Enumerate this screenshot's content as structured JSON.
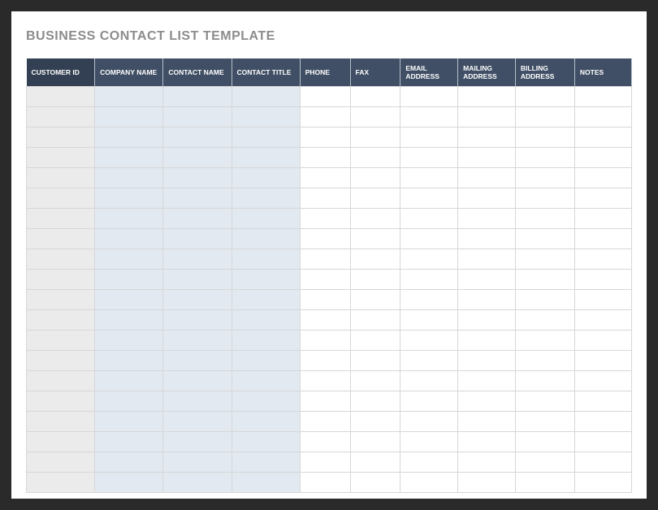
{
  "title": "BUSINESS CONTACT LIST TEMPLATE",
  "columns": [
    "CUSTOMER ID",
    "COMPANY NAME",
    "CONTACT NAME",
    "CONTACT TITLE",
    "PHONE",
    "FAX",
    "EMAIL ADDRESS",
    "MAILING ADDRESS",
    "BILLING ADDRESS",
    "NOTES"
  ],
  "row_count": 20,
  "colors": {
    "header_bg": "#404f65",
    "header_bg_first": "#333f52",
    "id_col_bg": "#ebebeb",
    "blue_col_bg": "#e2e9f1",
    "border": "#d7d7d7"
  }
}
